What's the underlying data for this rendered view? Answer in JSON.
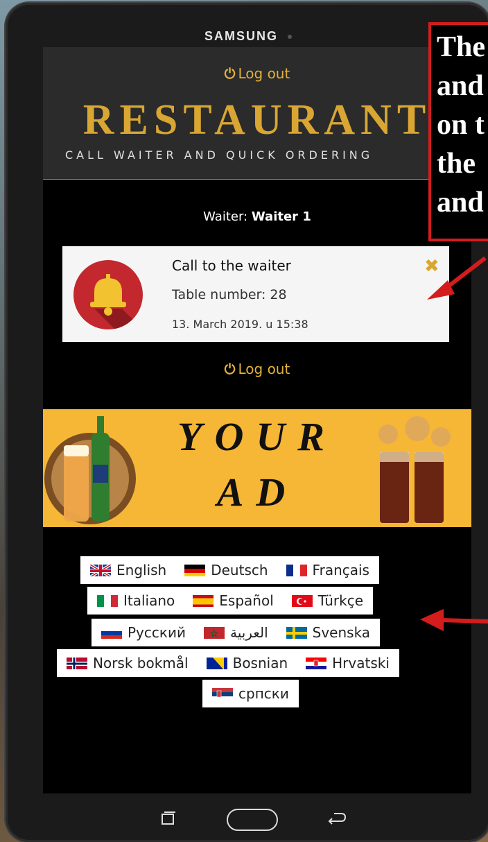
{
  "device": {
    "brand": "SAMSUNG"
  },
  "header": {
    "logout_label": "Log out",
    "title": "RESTAURANT",
    "tagline": "CALL WAITER AND QUICK ORDERING"
  },
  "waiter": {
    "prefix": "Waiter:",
    "name": "Waiter 1"
  },
  "notification": {
    "title": "Call to the waiter",
    "table": "Table number: 28",
    "datetime": "13. March 2019. u 15:38",
    "close": "✖"
  },
  "footer": {
    "logout_label": "Log out"
  },
  "ad": {
    "line1": "YOUR",
    "line2": "AD"
  },
  "languages": {
    "row1": [
      "English",
      "Deutsch",
      "Français"
    ],
    "row2": [
      "Italiano",
      "Español",
      "Türkçe"
    ],
    "row3": [
      "Русский",
      "العربية",
      "Svenska"
    ],
    "row4": [
      "Norsk bokmål",
      "Bosnian",
      "Hrvatski"
    ],
    "row5": [
      "српски"
    ]
  },
  "annotation": {
    "lines": [
      "The",
      "and",
      "on t",
      "the",
      "and"
    ]
  },
  "colors": {
    "accent": "#d9a633",
    "arrow": "#d41c1c",
    "bell_bg": "#c2282e",
    "ad_bg": "#f6b636"
  }
}
